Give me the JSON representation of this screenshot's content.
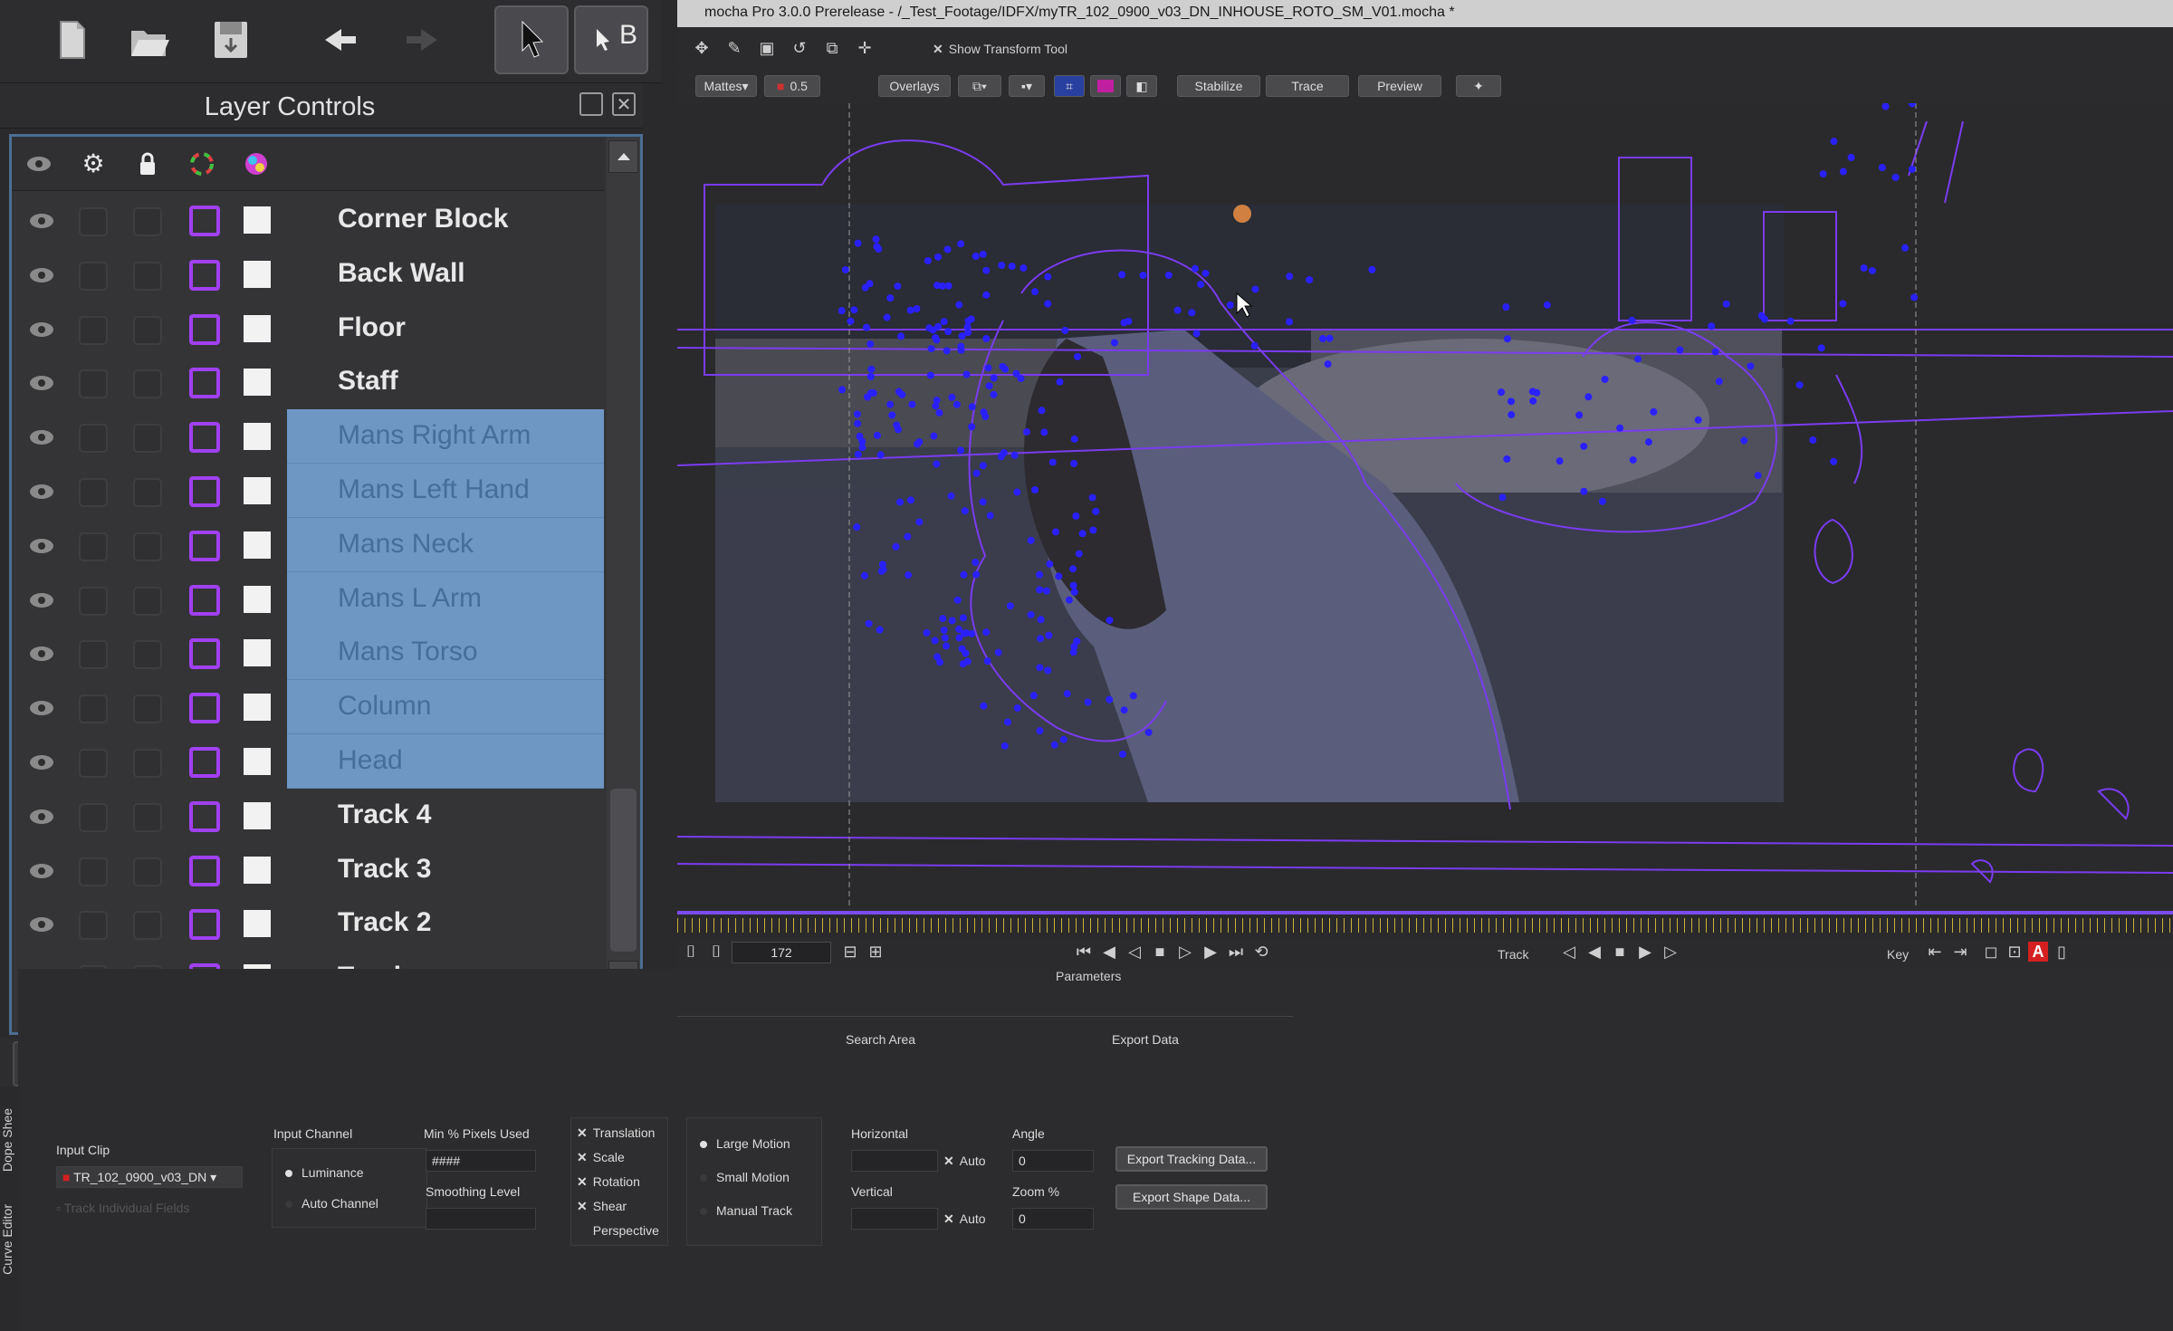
{
  "window": {
    "title": "mocha Pro 3.0.0 Prerelease - /_Test_Footage/IDFX/myTR_102_0900_v03_DN_INHOUSE_ROTO_SM_V01.mocha *"
  },
  "toolbar": {
    "icons": [
      "new-file-icon",
      "open-folder-icon",
      "save-icon",
      "undo-icon",
      "redo-icon",
      "select-tool-icon",
      "bezier-select-tool-icon"
    ],
    "b_label": "B"
  },
  "layer_controls": {
    "title": "Layer Controls",
    "header_icons": [
      "eye-icon",
      "gear-icon",
      "lock-icon",
      "color-wheel-icon",
      "matte-color-icon"
    ],
    "layers": [
      {
        "name": "Corner Block",
        "selected": false
      },
      {
        "name": "Back Wall",
        "selected": false
      },
      {
        "name": "Floor",
        "selected": false
      },
      {
        "name": "Staff",
        "selected": false
      },
      {
        "name": "Mans Right Arm",
        "selected": true
      },
      {
        "name": "Mans Left Hand",
        "selected": true
      },
      {
        "name": "Mans Neck",
        "selected": true
      },
      {
        "name": "Mans L Arm",
        "selected": true
      },
      {
        "name": "Mans Torso",
        "selected": true
      },
      {
        "name": "Column",
        "selected": true
      },
      {
        "name": "Head",
        "selected": true
      },
      {
        "name": "Track 4",
        "selected": false
      },
      {
        "name": "Track 3",
        "selected": false
      },
      {
        "name": "Track 2",
        "selected": false
      },
      {
        "name": "Track",
        "selected": false
      }
    ],
    "layer_outline_color": "#a040f0",
    "selection_color": "#6e97c4"
  },
  "transform_bar": {
    "show_transform_tool": "Show Transform Tool"
  },
  "view_bar": {
    "mattes": "Mattes",
    "opacity": "0.5",
    "overlays": "Overlays",
    "stabilize": "Stabilize",
    "trace": "Trace",
    "preview": "Preview"
  },
  "transport": {
    "current_frame": "172",
    "track_label": "Track",
    "key_label": "Key",
    "parameters_label": "Parameters"
  },
  "parameters": {
    "search_area_tab": "Search Area",
    "export_data_tab": "Export Data",
    "side_tabs": [
      "Dope Shee",
      "Curve Editor"
    ],
    "input_clip_label": "Input Clip",
    "input_clip_value": "TR_102_0900_v03_DN",
    "track_individual_fields": "Track Individual Fields",
    "input_channel_label": "Input Channel",
    "luminance": "Luminance",
    "auto_channel": "Auto Channel",
    "min_pixels_label": "Min % Pixels Used",
    "min_pixels_value": "####",
    "smoothing_label": "Smoothing Level",
    "motion_types": [
      {
        "label": "Translation",
        "checked": true
      },
      {
        "label": "Scale",
        "checked": true
      },
      {
        "label": "Rotation",
        "checked": true
      },
      {
        "label": "Shear",
        "checked": true
      },
      {
        "label": "Perspective",
        "checked": false
      }
    ],
    "motion_modes": [
      {
        "label": "Large Motion",
        "on": true
      },
      {
        "label": "Small Motion",
        "on": false
      },
      {
        "label": "Manual Track",
        "on": false
      }
    ],
    "horizontal_label": "Horizontal",
    "vertical_label": "Vertical",
    "auto_label": "Auto",
    "angle_label": "Angle",
    "angle_value": "0",
    "zoom_label": "Zoom %",
    "zoom_value": "0",
    "export_tracking": "Export Tracking Data...",
    "export_shape": "Export Shape Data..."
  },
  "colors": {
    "spline": "#7a3cf0",
    "control_point": "#2a20ff",
    "key_red": "#d42020"
  }
}
